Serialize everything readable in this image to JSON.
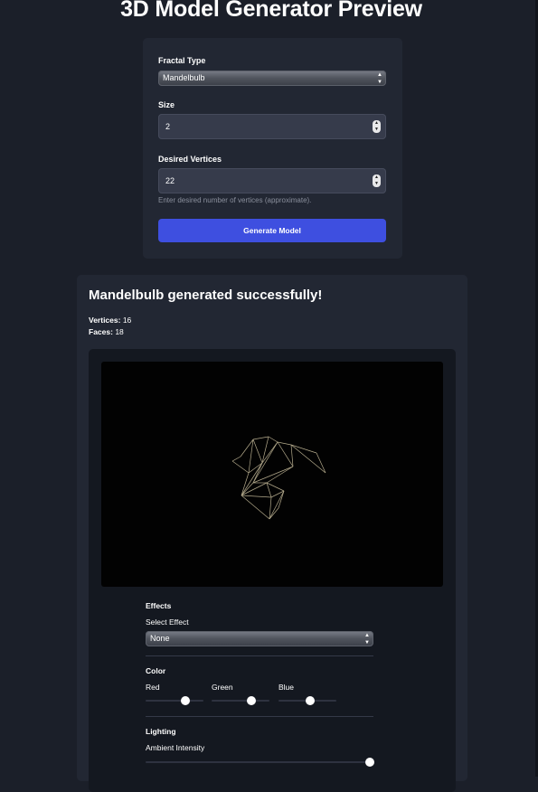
{
  "header": {
    "title": "3D Model Generator Preview"
  },
  "form": {
    "fractal_type_label": "Fractal Type",
    "fractal_type_value": "Mandelbulb",
    "size_label": "Size",
    "size_value": "2",
    "vertices_label": "Desired Vertices",
    "vertices_value": "22",
    "vertices_hint": "Enter desired number of vertices (approximate).",
    "generate_label": "Generate Model"
  },
  "result": {
    "title": "Mandelbulb generated successfully!",
    "vertices_label": "Vertices:",
    "vertices_value": "16",
    "faces_label": "Faces:",
    "faces_value": "18"
  },
  "controls": {
    "effects_title": "Effects",
    "select_effect_label": "Select Effect",
    "effect_value": "None",
    "color_title": "Color",
    "red_label": "Red",
    "red_value": 0.69,
    "green_label": "Green",
    "green_value": 0.69,
    "blue_label": "Blue",
    "blue_value": 0.55,
    "lighting_title": "Lighting",
    "ambient_label": "Ambient Intensity",
    "ambient_value": 1.0
  },
  "colors": {
    "background": "#1b1f29",
    "card": "#222733",
    "accent": "#3e4fe0",
    "wireframe": "#b4aa8c"
  }
}
